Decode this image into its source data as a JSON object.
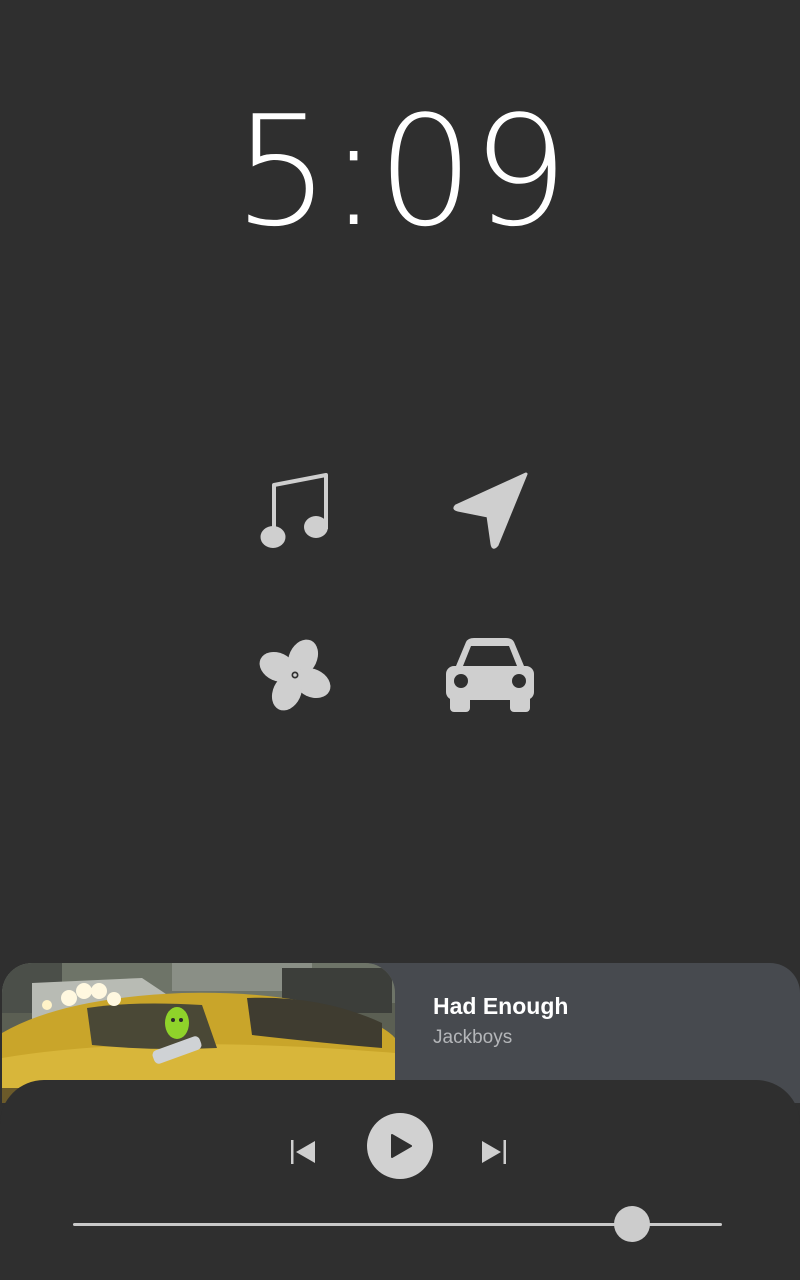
{
  "clock": {
    "time": "5:09"
  },
  "apps": [
    {
      "id": "music",
      "icon": "music-note-icon"
    },
    {
      "id": "navigation",
      "icon": "navigation-arrow-icon"
    },
    {
      "id": "climate",
      "icon": "fan-icon"
    },
    {
      "id": "vehicle",
      "icon": "car-icon"
    }
  ],
  "now_playing": {
    "title": "Had Enough",
    "artist": "Jackboys",
    "album_art_icon": "album-art"
  },
  "controls": {
    "previous_icon": "skip-previous-icon",
    "play_icon": "play-icon",
    "next_icon": "skip-next-icon"
  },
  "progress": {
    "fraction": 0.862
  },
  "colors": {
    "background": "#2f2f2f",
    "card": "#474a4f",
    "icon": "#cfcfcf",
    "text_primary": "#ffffff",
    "text_secondary": "#b4b6b9"
  }
}
